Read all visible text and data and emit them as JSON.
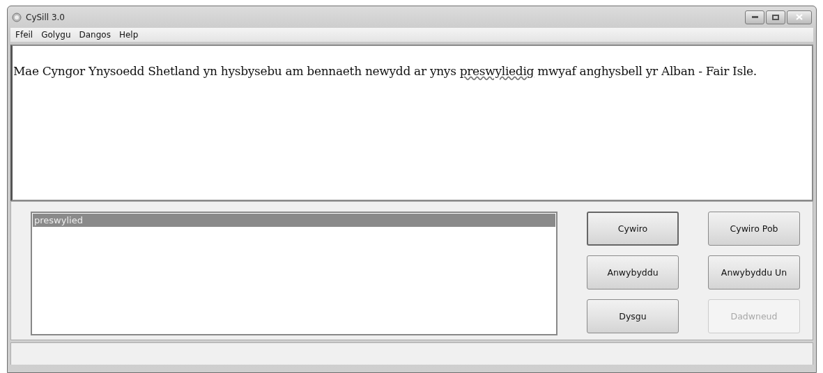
{
  "window": {
    "title": "CySill 3.0"
  },
  "menu": [
    "Ffeil",
    "Golygu",
    "Dangos",
    "Help"
  ],
  "text_segments": [
    {
      "text": "Mae Cyngor Ynysoedd Shetland yn hysbysebu am bennaeth newydd ar ynys ",
      "flagged": false
    },
    {
      "text": "preswyliedig",
      "flagged": true
    },
    {
      "text": " mwyaf anghysbell yr Alban - Fair Isle.",
      "flagged": false
    }
  ],
  "suggestions": [
    {
      "label": "preswylied",
      "selected": true
    }
  ],
  "buttons": [
    {
      "label": "Cywiro",
      "disabled": false,
      "default": true
    },
    {
      "label": "Cywiro Pob",
      "disabled": false,
      "default": false
    },
    {
      "label": "Anwybyddu",
      "disabled": false,
      "default": false
    },
    {
      "label": "Anwybyddu Un",
      "disabled": false,
      "default": false
    },
    {
      "label": "Dysgu",
      "disabled": false,
      "default": false
    },
    {
      "label": "Dadwneud",
      "disabled": true,
      "default": false
    }
  ]
}
